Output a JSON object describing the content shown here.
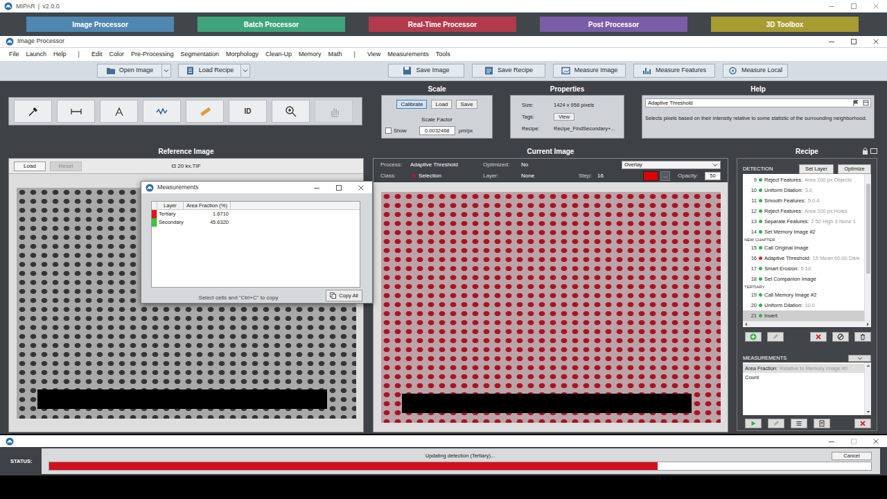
{
  "app": {
    "name": "MIPAR",
    "divider": "|",
    "version": "v2.0.0"
  },
  "modules": [
    {
      "label": "Image Processor",
      "color": "#4f87b0"
    },
    {
      "label": "Batch Processor",
      "color": "#3fa47b"
    },
    {
      "label": "Real-Time Processor",
      "color": "#b23a4b"
    },
    {
      "label": "Post Processor",
      "color": "#7b5ca6"
    },
    {
      "label": "3D Toolbox",
      "color": "#a89b30"
    }
  ],
  "window": {
    "title": "Image Processor"
  },
  "menu": [
    {
      "kind": "menu",
      "label": "File"
    },
    {
      "kind": "menu",
      "label": "Launch"
    },
    {
      "kind": "menu",
      "label": "Help"
    },
    {
      "kind": "separator",
      "label": "|"
    },
    {
      "kind": "menu",
      "label": "Edit"
    },
    {
      "kind": "menu",
      "label": "Color"
    },
    {
      "kind": "menu",
      "label": "Pre-Processing"
    },
    {
      "kind": "menu",
      "label": "Segmentation"
    },
    {
      "kind": "menu",
      "label": "Morphology"
    },
    {
      "kind": "menu",
      "label": "Clean-Up"
    },
    {
      "kind": "menu",
      "label": "Memory"
    },
    {
      "kind": "menu",
      "label": "Math"
    },
    {
      "kind": "separator",
      "label": "|"
    },
    {
      "kind": "menu",
      "label": "View"
    },
    {
      "kind": "menu",
      "label": "Measurements"
    },
    {
      "kind": "menu",
      "label": "Tools"
    }
  ],
  "toolbar": [
    {
      "label": "Open Image",
      "kind": "split"
    },
    {
      "label": "Load Recipe",
      "kind": "split"
    },
    {
      "label": "Save Image",
      "kind": "plain"
    },
    {
      "label": "Save Recipe",
      "kind": "plain"
    },
    {
      "label": "Measure Image",
      "kind": "plain"
    },
    {
      "label": "Measure Features",
      "kind": "plain"
    },
    {
      "label": "Measure Local",
      "kind": "plain"
    }
  ],
  "tools": [
    {
      "kind": "icon",
      "disabled": false
    },
    {
      "kind": "icon",
      "disabled": false
    },
    {
      "kind": "icon",
      "disabled": false
    },
    {
      "kind": "icon",
      "disabled": false
    },
    {
      "kind": "icon",
      "disabled": false
    },
    {
      "kind": "text",
      "label": "ID",
      "disabled": false
    },
    {
      "kind": "icon",
      "disabled": false
    },
    {
      "kind": "icon",
      "disabled": true
    }
  ],
  "scale": {
    "title": "Scale",
    "buttons": [
      {
        "label": "Calibrate",
        "selected": true
      },
      {
        "label": "Load",
        "selected": false
      },
      {
        "label": "Save",
        "selected": false
      }
    ],
    "factor_label": "Scale Factor",
    "factor": "0.0032468",
    "unit": "µm/px",
    "show_label": "Show",
    "show_checked": false
  },
  "properties": {
    "title": "Properties",
    "size_label": "Size:",
    "size": "1424 x 958 pixels",
    "tags_label": "Tags:",
    "tags_button": "View",
    "recipe_label": "Recipe:",
    "recipe": "Recipe_FindSecondary+..."
  },
  "help": {
    "title": "Help",
    "topic": "Adaptive Threshold",
    "text": "Selects pixels based on their intensity relative to some statistic of the surrounding neighborhood."
  },
  "reference": {
    "title": "Reference Image",
    "load": "Load",
    "reset": "Reset",
    "reset_disabled": true,
    "file": "t3 20 kx.TIF"
  },
  "current": {
    "title": "Current Image",
    "process_label": "Process:",
    "process": "Adaptive Threshold",
    "optimized_label": "Optimized:",
    "optimized": "No",
    "class_label": "Class:",
    "class_name": "Selection",
    "class_color": "#c8102e",
    "layer_label": "Layer:",
    "layer": "None",
    "step_label": "Step:",
    "step": "16",
    "view": "Overlay",
    "overlay_color": "#e00000",
    "more": "...",
    "opacity_label": "Opacity:",
    "opacity": "50"
  },
  "recipe": {
    "title": "Recipe",
    "section": "DETECTION",
    "set_layer": "Set Layer",
    "optimize": "Optimize",
    "steps": [
      {
        "kind": "step",
        "number": "9",
        "name": "Reject Features:",
        "params": "Area 200 px Objects",
        "color": "#2fb34a",
        "selected": false
      },
      {
        "kind": "step",
        "number": "10",
        "name": "Uniform Dilation:",
        "params": "3.0",
        "color": "#2fb34a",
        "selected": false
      },
      {
        "kind": "step",
        "number": "11",
        "name": "Smooth Features:",
        "params": "5 0.4",
        "color": "#2fb34a",
        "selected": false
      },
      {
        "kind": "step",
        "number": "12",
        "name": "Reject Features:",
        "params": "Area 200 px Holes",
        "color": "#2fb34a",
        "selected": false
      },
      {
        "kind": "step",
        "number": "13",
        "name": "Separate Features:",
        "params": "2.50 High 3 None 1",
        "color": "#2fb34a",
        "selected": false
      },
      {
        "kind": "step",
        "number": "14",
        "name": "Set Memory Image #2",
        "color": "#2fb34a",
        "selected": false
      },
      {
        "kind": "chapter",
        "label": "NEW CHAPTER"
      },
      {
        "kind": "step",
        "number": "15",
        "name": "Call Original Image",
        "color": "#2fb34a",
        "selected": false
      },
      {
        "kind": "step",
        "number": "16",
        "name": "Adaptive Threshold:",
        "params": "15 Mean 90.00 Dark",
        "color": "#d9262b",
        "selected": false
      },
      {
        "kind": "step",
        "number": "17",
        "name": "Smart Erosion:",
        "params": "5 10",
        "color": "#2fb34a",
        "selected": false
      },
      {
        "kind": "step",
        "number": "18",
        "name": "Set Companion Image",
        "color": "#2fb34a",
        "selected": false
      },
      {
        "kind": "chapter",
        "label": "TERTIARY"
      },
      {
        "kind": "step",
        "number": "19",
        "name": "Call Memory Image #2",
        "color": "#2fb34a",
        "selected": false
      },
      {
        "kind": "step",
        "number": "20",
        "name": "Uniform Dilation:",
        "params": "10.0",
        "color": "#2fb34a",
        "selected": false
      },
      {
        "kind": "step",
        "number": "21",
        "name": "Invert",
        "color": "#2fb34a",
        "selected": true
      }
    ],
    "measurements_title": "MEASUREMENTS",
    "measurements": [
      {
        "name": "Area Fraction:",
        "detail": "Relative to Memory Image #0",
        "selected": true
      },
      {
        "name": "Count",
        "selected": false
      }
    ]
  },
  "measurements_window": {
    "title": "Measurements",
    "columns": [
      "Layer",
      "Area Fraction (%)"
    ],
    "rows": [
      {
        "layer": "Tertiary",
        "value": "1.6710",
        "color": "#e0161c"
      },
      {
        "layer": "Secondary",
        "value": "45.6320",
        "color": "#3cc43c"
      }
    ],
    "hint": "Select cells and \"Ctrl+C\" to copy",
    "copy_all": "Copy All"
  },
  "status": {
    "label": "STATUS:",
    "message": "Updating detection (Tertiary)...",
    "level": 0.74,
    "cancel": "Cancel"
  }
}
